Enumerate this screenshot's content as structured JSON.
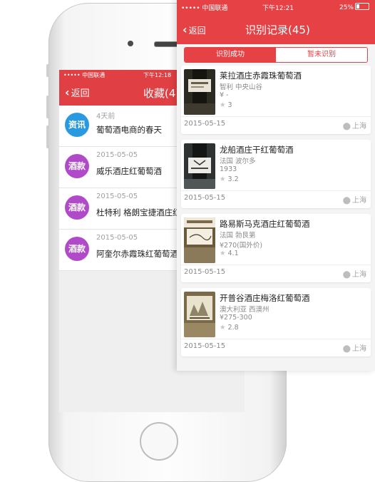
{
  "back_screen": {
    "status": {
      "carrier": "••••• 中国联通",
      "time": "下午12:18"
    },
    "nav": {
      "back_label": "返回",
      "title": "收藏(4)"
    },
    "items": [
      {
        "badge": "资讯",
        "badge_color": "#2a9ae0",
        "date": "4天前",
        "text": "葡萄酒电商的春天"
      },
      {
        "badge": "酒款",
        "badge_color": "#b04ac8",
        "date": "2015-05-05",
        "text": "威乐酒庄红葡萄酒"
      },
      {
        "badge": "酒款",
        "badge_color": "#b04ac8",
        "date": "2015-05-05",
        "text": "杜特利 格朗宝捷酒庄红"
      },
      {
        "badge": "酒款",
        "badge_color": "#b04ac8",
        "date": "2015-05-05",
        "text": "阿奎尔赤霞珠红葡萄酒"
      }
    ]
  },
  "front_screen": {
    "status": {
      "carrier": "••••• 中国联通",
      "time": "下午12:21",
      "battery": "25%"
    },
    "nav": {
      "back_label": "返回",
      "title": "识别记录(45)"
    },
    "tabs": [
      {
        "label": "识别成功",
        "active": true
      },
      {
        "label": "暂未识别",
        "active": false
      }
    ],
    "records": [
      {
        "name": "莱拉酒庄赤霞珠葡萄酒",
        "origin": "智利 中央山谷",
        "vintage": "¥ -",
        "rating": "3",
        "date": "2015-05-15",
        "location": "上海",
        "thumb_color": "#3a3a2e"
      },
      {
        "name": "龙船酒庄干红葡萄酒",
        "origin": "法国 波尔多",
        "vintage": "1933",
        "rating": "3.2",
        "date": "2015-05-15",
        "location": "上海",
        "thumb_color": "#2c3030"
      },
      {
        "name": "路易斯马克酒庄红葡萄酒",
        "origin": "法国 勃艮第",
        "vintage": "¥270(国外价)",
        "rating": "4.1",
        "date": "2015-05-15",
        "location": "上海",
        "thumb_color": "#5a4a30"
      },
      {
        "name": "开普谷酒庄梅洛红葡萄酒",
        "origin": "澳大利亚 西澳州",
        "vintage": "¥275-300",
        "rating": "2.8",
        "date": "2015-05-15",
        "location": "上海",
        "thumb_color": "#6a5a38"
      }
    ]
  }
}
